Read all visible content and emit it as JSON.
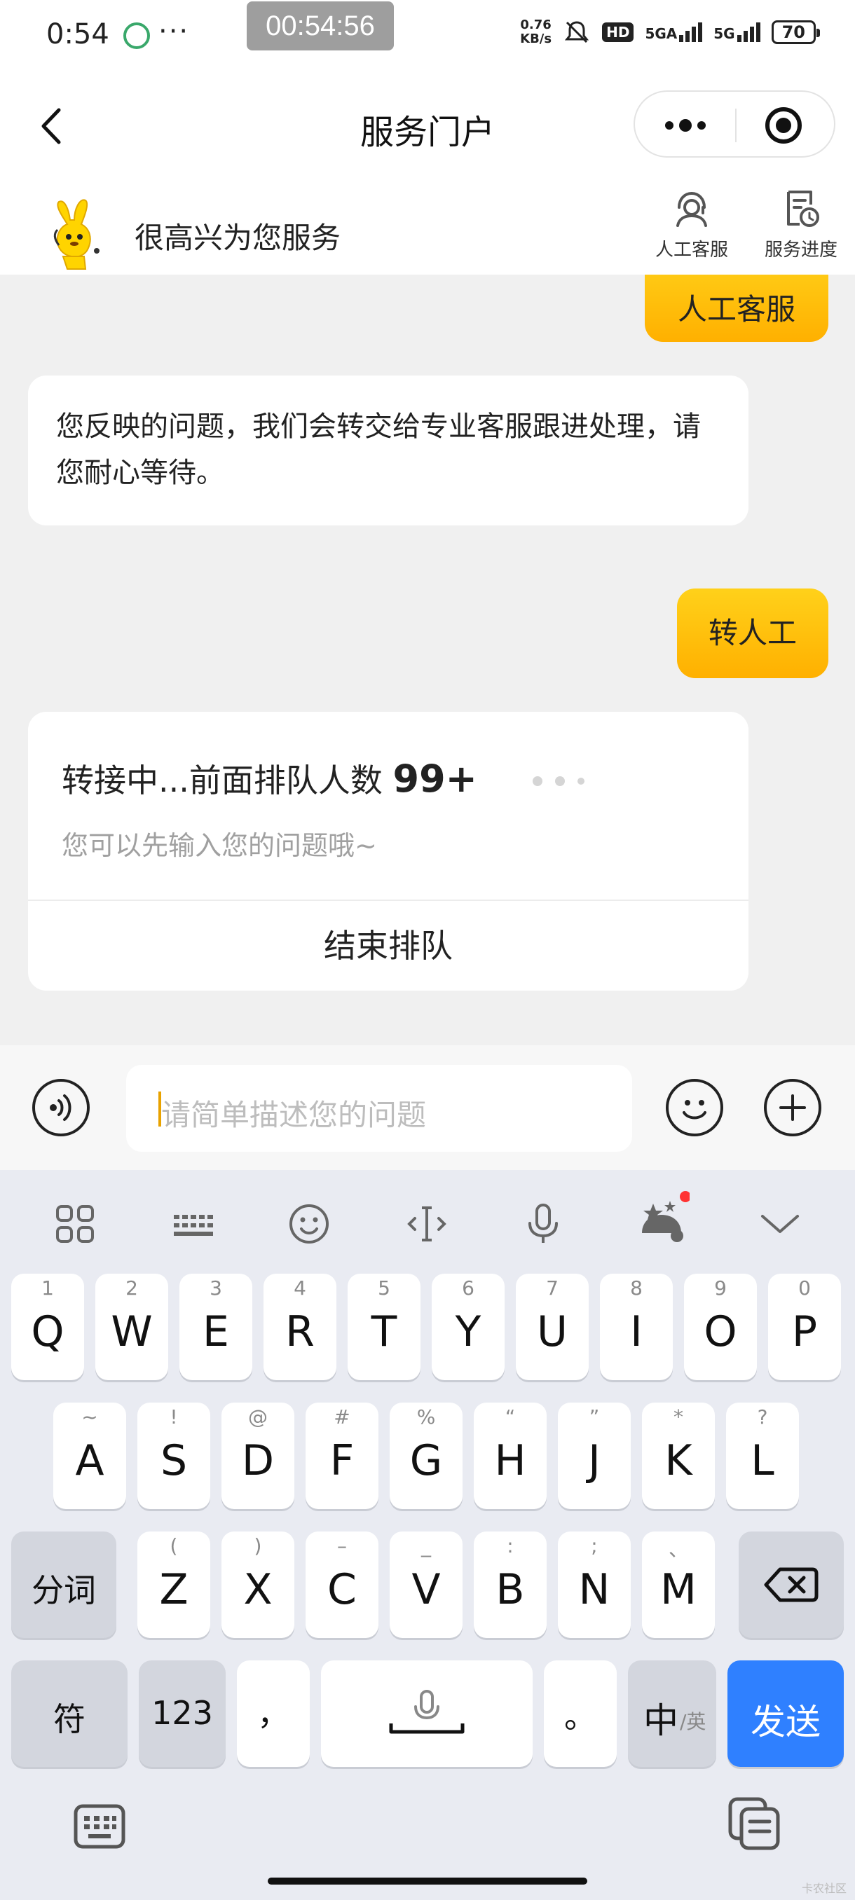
{
  "status_bar": {
    "time": "0:54",
    "dots": "···",
    "call_timer": "00:54:56",
    "net_speed_value": "0.76",
    "net_speed_unit": "KB/s",
    "hd": "HD",
    "signal1": "5GA",
    "signal2": "5G",
    "battery": "70"
  },
  "nav": {
    "title": "服务门户"
  },
  "header": {
    "greeting": "很高兴为您服务",
    "human_service_label": "人工客服",
    "service_progress_label": "服务进度"
  },
  "chat": {
    "msg_user_1": "人工客服",
    "msg_bot_1": "您反映的问题，我们会转交给专业客服跟进处理，请您耐心等待。",
    "msg_user_2": "转人工",
    "queue_text": "转接中...前面排队人数",
    "queue_count": "99+",
    "queue_hint": "您可以先输入您的问题哦~",
    "end_queue": "结束排队"
  },
  "input": {
    "placeholder": "请简单描述您的问题"
  },
  "keyboard": {
    "row1": [
      {
        "hint": "1",
        "key": "Q"
      },
      {
        "hint": "2",
        "key": "W"
      },
      {
        "hint": "3",
        "key": "E"
      },
      {
        "hint": "4",
        "key": "R"
      },
      {
        "hint": "5",
        "key": "T"
      },
      {
        "hint": "6",
        "key": "Y"
      },
      {
        "hint": "7",
        "key": "U"
      },
      {
        "hint": "8",
        "key": "I"
      },
      {
        "hint": "9",
        "key": "O"
      },
      {
        "hint": "0",
        "key": "P"
      }
    ],
    "row2": [
      {
        "hint": "~",
        "key": "A"
      },
      {
        "hint": "!",
        "key": "S"
      },
      {
        "hint": "@",
        "key": "D"
      },
      {
        "hint": "#",
        "key": "F"
      },
      {
        "hint": "%",
        "key": "G"
      },
      {
        "hint": "“",
        "key": "H"
      },
      {
        "hint": "”",
        "key": "J"
      },
      {
        "hint": "*",
        "key": "K"
      },
      {
        "hint": "?",
        "key": "L"
      }
    ],
    "row3": [
      {
        "hint": "(",
        "key": "Z"
      },
      {
        "hint": ")",
        "key": "X"
      },
      {
        "hint": "–",
        "key": "C"
      },
      {
        "hint": "_",
        "key": "V"
      },
      {
        "hint": ":",
        "key": "B"
      },
      {
        "hint": ";",
        "key": "N"
      },
      {
        "hint": "、",
        "key": "M"
      }
    ],
    "segment_label": "分词",
    "symbol_label": "符",
    "num_label": "123",
    "comma_label": "，",
    "period_label": "。",
    "lang_main": "中",
    "lang_alt": "/英",
    "send_label": "发送"
  },
  "watermark": "卡农社区",
  "colors": {
    "accent_yellow": "#ffc107",
    "send_blue": "#2f80ff"
  }
}
